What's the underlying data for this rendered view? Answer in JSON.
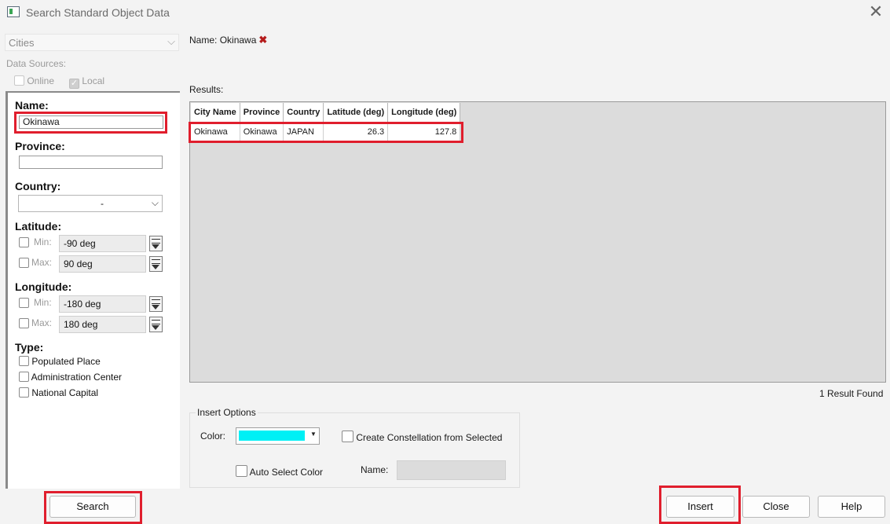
{
  "window": {
    "title": "Search Standard Object Data"
  },
  "left_panel": {
    "category": "Cities",
    "data_sources_label": "Data Sources:",
    "data_sources": [
      {
        "label": "Online",
        "checked": false
      },
      {
        "label": "Local",
        "checked": true
      }
    ],
    "name_label": "Name:",
    "name_value": "Okinawa",
    "province_label": "Province:",
    "province_value": "",
    "country_label": "Country:",
    "country_value": "-",
    "latitude_label": "Latitude:",
    "latitude_min_label": "Min:",
    "latitude_min": "-90 deg",
    "latitude_max_label": "Max:",
    "latitude_max": "90 deg",
    "longitude_label": "Longitude:",
    "longitude_min_label": "Min:",
    "longitude_min": "-180 deg",
    "longitude_max_label": "Max:",
    "longitude_max": "180 deg",
    "type_label": "Type:",
    "types": [
      "Populated Place",
      "Administration Center",
      "National Capital"
    ],
    "search_button": "Search"
  },
  "criteria": {
    "prefix": "Name:",
    "value": "Okinawa"
  },
  "results": {
    "label": "Results:",
    "columns": [
      "City Name",
      "Province",
      "Country",
      "Latitude (deg)",
      "Longitude (deg)"
    ],
    "rows": [
      [
        "Okinawa",
        "Okinawa",
        "JAPAN",
        "26.3",
        "127.8"
      ]
    ],
    "found_text": "1 Result Found"
  },
  "insert_options": {
    "title": "Insert Options",
    "color_label": "Color:",
    "color_value": "#00f0f5",
    "create_constellation_label": "Create Constellation from Selected",
    "auto_select_color_label": "Auto Select Color",
    "name_label": "Name:",
    "name_value": ""
  },
  "buttons": {
    "insert": "Insert",
    "close": "Close",
    "help": "Help"
  },
  "colors": {
    "highlight": "#e01e2d",
    "grid_bg": "#dcdcdc"
  }
}
